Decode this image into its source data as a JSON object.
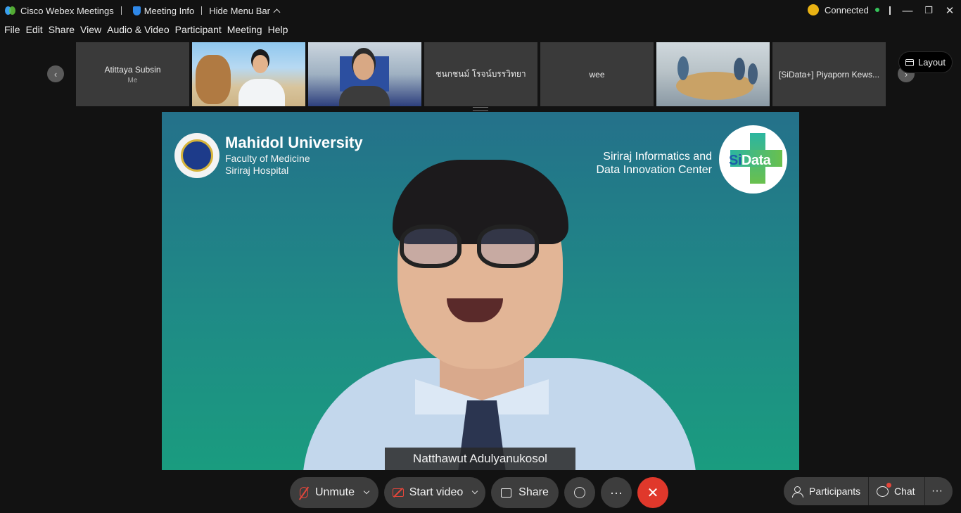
{
  "titlebar": {
    "app_name": "Cisco Webex Meetings",
    "sep": "|",
    "meeting_info": "Meeting Info",
    "hide_menu": "Hide Menu Bar",
    "status": "Connected",
    "minimize": "—",
    "restore": "❐",
    "close": "✕"
  },
  "menu": {
    "file": "File",
    "edit": "Edit",
    "share": "Share",
    "view": "View",
    "audio_video": "Audio & Video",
    "participant": "Participant",
    "meeting": "Meeting",
    "help": "Help"
  },
  "thumbnails": [
    {
      "name": "Atittaya Subsin",
      "sub": "Me"
    },
    {
      "name": "",
      "sub": ""
    },
    {
      "name": "",
      "sub": ""
    },
    {
      "name": "ชนกชนม์ โรจน์บรรวิทยา",
      "sub": ""
    },
    {
      "name": "wee",
      "sub": ""
    },
    {
      "name": "",
      "sub": ""
    },
    {
      "name": "[SiData+] Piyaporn Kews...",
      "sub": ""
    }
  ],
  "strip": {
    "prev": "‹",
    "next": "›",
    "layout": "Layout"
  },
  "main_video": {
    "org_title": "Mahidol University",
    "org_line1": "Faculty of Medicine",
    "org_line2": "Siriraj Hospital",
    "center_line1": "Siriraj Informatics and",
    "center_line2": "Data Innovation Center",
    "logo_si": "Si",
    "logo_data": "Data",
    "speaker": "Natthawut Adulyanukosol"
  },
  "controls": {
    "unmute": "Unmute",
    "start_video": "Start video",
    "share": "Share",
    "more": "···",
    "end": "✕",
    "participants": "Participants",
    "chat": "Chat"
  },
  "colors": {
    "end_call": "#e0382b",
    "muted": "#e5463b",
    "connected": "#35c35a"
  }
}
